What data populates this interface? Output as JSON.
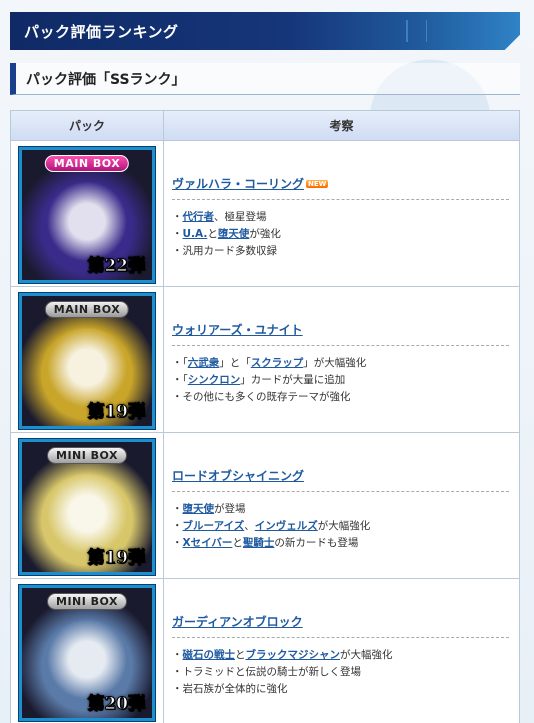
{
  "banner": {
    "title": "パック評価ランキング"
  },
  "section": {
    "title": "パック評価「SSランク」"
  },
  "table": {
    "headers": {
      "pack": "パック",
      "analysis": "考察"
    },
    "rows": [
      {
        "box_label": "MAIN BOX",
        "box_number": "第22弾",
        "box_style": "main",
        "theme_color": "#3a2b8a",
        "name": "ヴァルハラ・コーリング",
        "badge": "NEW",
        "notes": [
          [
            {
              "t": "・"
            },
            {
              "t": "代行者",
              "link": true
            },
            {
              "t": "、極星登場"
            }
          ],
          [
            {
              "t": "・"
            },
            {
              "t": "U.A.",
              "link": true
            },
            {
              "t": "と"
            },
            {
              "t": "堕天使",
              "link": true
            },
            {
              "t": "が強化"
            }
          ],
          [
            {
              "t": "・汎用カード多数収録"
            }
          ]
        ]
      },
      {
        "box_label": "MAIN BOX",
        "box_number": "第19弾",
        "box_style": "main-silver",
        "theme_color": "#c9a52a",
        "name": "ウォリアーズ・ユナイト",
        "badge": "",
        "notes": [
          [
            {
              "t": "・「"
            },
            {
              "t": "六武衆",
              "link": true
            },
            {
              "t": "」と「"
            },
            {
              "t": "スクラップ",
              "link": true
            },
            {
              "t": "」が大幅強化"
            }
          ],
          [
            {
              "t": "・「"
            },
            {
              "t": "シンクロン",
              "link": true
            },
            {
              "t": "」カードが大量に追加"
            }
          ],
          [
            {
              "t": "・その他にも多くの既存テーマが強化"
            }
          ]
        ]
      },
      {
        "box_label": "MINI BOX",
        "box_number": "第19弾",
        "box_style": "mini",
        "theme_color": "#d8c76a",
        "name": "ロードオブシャイニング",
        "badge": "",
        "notes": [
          [
            {
              "t": "・"
            },
            {
              "t": "堕天使",
              "link": true
            },
            {
              "t": "が登場"
            }
          ],
          [
            {
              "t": "・"
            },
            {
              "t": "ブルーアイズ",
              "link": true
            },
            {
              "t": "、"
            },
            {
              "t": "インヴェルズ",
              "link": true
            },
            {
              "t": "が大幅強化"
            }
          ],
          [
            {
              "t": "・"
            },
            {
              "t": "Xセイバー",
              "link": true
            },
            {
              "t": "と"
            },
            {
              "t": "聖騎士",
              "link": true
            },
            {
              "t": "の新カードも登場"
            }
          ]
        ]
      },
      {
        "box_label": "MINI BOX",
        "box_number": "第20弾",
        "box_style": "mini",
        "theme_color": "#5a7aa8",
        "name": "ガーディアンオブロック",
        "badge": "",
        "notes": [
          [
            {
              "t": "・"
            },
            {
              "t": "磁石の戦士",
              "link": true
            },
            {
              "t": "と"
            },
            {
              "t": "ブラックマジシャン",
              "link": true
            },
            {
              "t": "が大幅強化"
            }
          ],
          [
            {
              "t": "・トラミッドと伝説の騎士が新しく登場"
            }
          ],
          [
            {
              "t": "・岩石族が全体的に強化"
            }
          ]
        ]
      }
    ]
  }
}
